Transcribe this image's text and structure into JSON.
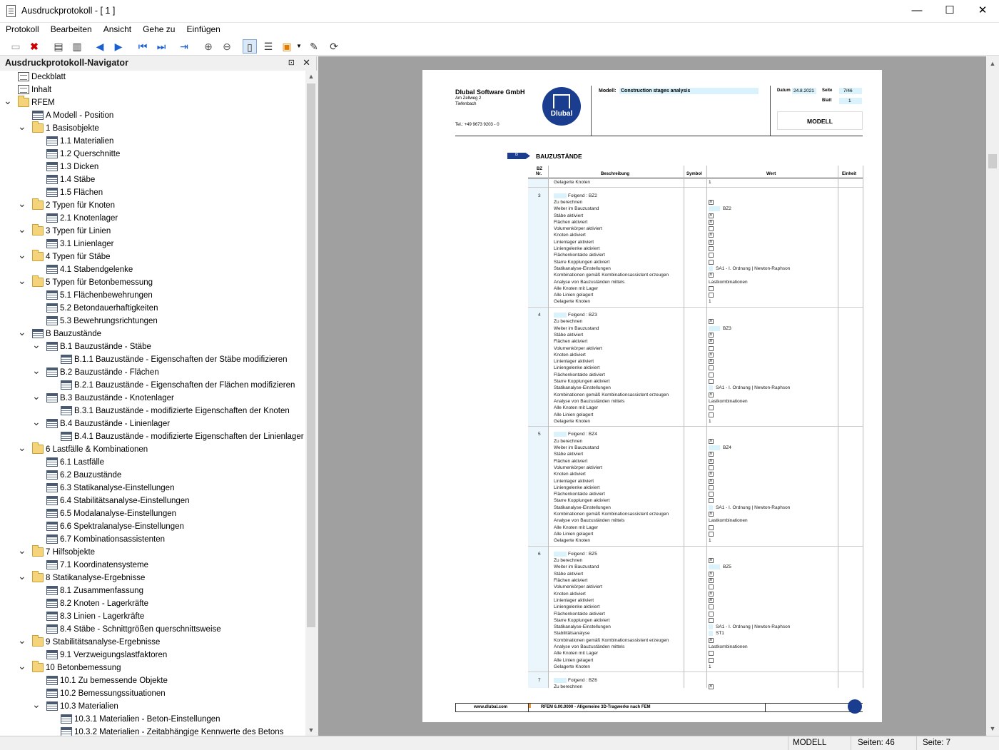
{
  "window": {
    "title": "Ausdruckprotokoll - [ 1 ]",
    "minimize": "—",
    "maximize": "☐",
    "close": "✕"
  },
  "menu": [
    "Protokoll",
    "Bearbeiten",
    "Ansicht",
    "Gehe zu",
    "Einfügen"
  ],
  "toolbar": {
    "icons": [
      "new-icon",
      "delete-icon",
      "print-icon",
      "print-setup-icon",
      "prev-icon",
      "next-icon",
      "first-icon",
      "last-icon",
      "goto-icon",
      "zoom-in-icon",
      "zoom-out-icon",
      "page-view-icon",
      "table-settings-icon",
      "print-options-icon",
      "dropdown-icon",
      "edit-icon",
      "refresh-icon"
    ]
  },
  "navigator": {
    "title": "Ausdruckprotokoll-Navigator",
    "pin": "⊡",
    "close": "✕",
    "items": [
      {
        "label": "Deckblatt",
        "level": 0,
        "icon": "doc",
        "chev": ""
      },
      {
        "label": "Inhalt",
        "level": 0,
        "icon": "doc",
        "chev": ""
      },
      {
        "label": "RFEM",
        "level": 0,
        "icon": "folder",
        "chev": "v"
      },
      {
        "label": "A Modell - Position",
        "level": 1,
        "icon": "tbl",
        "chev": ""
      },
      {
        "label": "1 Basisobjekte",
        "level": 1,
        "icon": "folder",
        "chev": "v"
      },
      {
        "label": "1.1 Materialien",
        "level": 2,
        "icon": "tbl",
        "chev": ""
      },
      {
        "label": "1.2 Querschnitte",
        "level": 2,
        "icon": "tbl",
        "chev": ""
      },
      {
        "label": "1.3 Dicken",
        "level": 2,
        "icon": "tbl",
        "chev": ""
      },
      {
        "label": "1.4 Stäbe",
        "level": 2,
        "icon": "tbl",
        "chev": ""
      },
      {
        "label": "1.5 Flächen",
        "level": 2,
        "icon": "tbl",
        "chev": ""
      },
      {
        "label": "2 Typen für Knoten",
        "level": 1,
        "icon": "folder",
        "chev": "v"
      },
      {
        "label": "2.1 Knotenlager",
        "level": 2,
        "icon": "tbl",
        "chev": ""
      },
      {
        "label": "3 Typen für Linien",
        "level": 1,
        "icon": "folder",
        "chev": "v"
      },
      {
        "label": "3.1 Linienlager",
        "level": 2,
        "icon": "tbl",
        "chev": ""
      },
      {
        "label": "4 Typen für Stäbe",
        "level": 1,
        "icon": "folder",
        "chev": "v"
      },
      {
        "label": "4.1 Stabendgelenke",
        "level": 2,
        "icon": "tbl",
        "chev": ""
      },
      {
        "label": "5 Typen für Betonbemessung",
        "level": 1,
        "icon": "folder",
        "chev": "v"
      },
      {
        "label": "5.1 Flächenbewehrungen",
        "level": 2,
        "icon": "tbl",
        "chev": ""
      },
      {
        "label": "5.2 Betondauerhaftigkeiten",
        "level": 2,
        "icon": "tbl",
        "chev": ""
      },
      {
        "label": "5.3 Bewehrungsrichtungen",
        "level": 2,
        "icon": "tbl",
        "chev": ""
      },
      {
        "label": "B Bauzustände",
        "level": 1,
        "icon": "tbl",
        "chev": "v"
      },
      {
        "label": "B.1 Bauzustände - Stäbe",
        "level": 2,
        "icon": "tbl",
        "chev": "v"
      },
      {
        "label": "B.1.1 Bauzustände - Eigenschaften der Stäbe modifizieren",
        "level": 3,
        "icon": "tbl",
        "chev": ""
      },
      {
        "label": "B.2 Bauzustände - Flächen",
        "level": 2,
        "icon": "tbl",
        "chev": "v"
      },
      {
        "label": "B.2.1 Bauzustände - Eigenschaften der Flächen modifizieren",
        "level": 3,
        "icon": "tbl",
        "chev": ""
      },
      {
        "label": "B.3 Bauzustände - Knotenlager",
        "level": 2,
        "icon": "tbl",
        "chev": "v"
      },
      {
        "label": "B.3.1 Bauzustände - modifizierte Eigenschaften der Knoten",
        "level": 3,
        "icon": "tbl",
        "chev": ""
      },
      {
        "label": "B.4 Bauzustände - Linienlager",
        "level": 2,
        "icon": "tbl",
        "chev": "v"
      },
      {
        "label": "B.4.1 Bauzustände - modifizierte Eigenschaften der Linienlager",
        "level": 3,
        "icon": "tbl",
        "chev": ""
      },
      {
        "label": "6 Lastfälle & Kombinationen",
        "level": 1,
        "icon": "folder",
        "chev": "v"
      },
      {
        "label": "6.1 Lastfälle",
        "level": 2,
        "icon": "tbl",
        "chev": ""
      },
      {
        "label": "6.2 Bauzustände",
        "level": 2,
        "icon": "tbl",
        "chev": ""
      },
      {
        "label": "6.3 Statikanalyse-Einstellungen",
        "level": 2,
        "icon": "tbl",
        "chev": ""
      },
      {
        "label": "6.4 Stabilitätsanalyse-Einstellungen",
        "level": 2,
        "icon": "tbl",
        "chev": ""
      },
      {
        "label": "6.5 Modalanalyse-Einstellungen",
        "level": 2,
        "icon": "tbl",
        "chev": ""
      },
      {
        "label": "6.6 Spektralanalyse-Einstellungen",
        "level": 2,
        "icon": "tbl",
        "chev": ""
      },
      {
        "label": "6.7 Kombinationsassistenten",
        "level": 2,
        "icon": "tbl",
        "chev": ""
      },
      {
        "label": "7 Hilfsobjekte",
        "level": 1,
        "icon": "folder",
        "chev": "v"
      },
      {
        "label": "7.1 Koordinatensysteme",
        "level": 2,
        "icon": "tbl",
        "chev": ""
      },
      {
        "label": "8 Statikanalyse-Ergebnisse",
        "level": 1,
        "icon": "folder",
        "chev": "v"
      },
      {
        "label": "8.1 Zusammenfassung",
        "level": 2,
        "icon": "tbl",
        "chev": ""
      },
      {
        "label": "8.2 Knoten - Lagerkräfte",
        "level": 2,
        "icon": "tbl",
        "chev": ""
      },
      {
        "label": "8.3 Linien - Lagerkräfte",
        "level": 2,
        "icon": "tbl",
        "chev": ""
      },
      {
        "label": "8.4 Stäbe - Schnittgrößen querschnittsweise",
        "level": 2,
        "icon": "tbl",
        "chev": ""
      },
      {
        "label": "9 Stabilitätsanalyse-Ergebnisse",
        "level": 1,
        "icon": "folder",
        "chev": "v"
      },
      {
        "label": "9.1 Verzweigungslastfaktoren",
        "level": 2,
        "icon": "tbl",
        "chev": ""
      },
      {
        "label": "10 Betonbemessung",
        "level": 1,
        "icon": "folder",
        "chev": "v"
      },
      {
        "label": "10.1 Zu bemessende Objekte",
        "level": 2,
        "icon": "tbl",
        "chev": ""
      },
      {
        "label": "10.2 Bemessungssituationen",
        "level": 2,
        "icon": "tbl",
        "chev": ""
      },
      {
        "label": "10.3 Materialien",
        "level": 2,
        "icon": "tbl",
        "chev": "v"
      },
      {
        "label": "10.3.1 Materialien - Beton-Einstellungen",
        "level": 3,
        "icon": "tbl",
        "chev": ""
      },
      {
        "label": "10.3.2 Materialien - Zeitabhängige Kennwerte des Betons",
        "level": 3,
        "icon": "tbl",
        "chev": ""
      }
    ]
  },
  "page": {
    "company": "Dlubal Software GmbH",
    "street": "Am Zellweg 2",
    "city": "Tiefenbach",
    "tel": "Tel.: +49 9673 9203 - 0",
    "logo_text": "Dlubal",
    "model_label": "Modell:",
    "model_value": "Construction stages analysis",
    "date_label": "Datum",
    "date_value": "24.8.2021",
    "seite_label": "Seite",
    "seite_value": "7/46",
    "blatt_label": "Blatt",
    "blatt_value": "1",
    "section_box": "MODELL",
    "chapter_tag": "B",
    "chapter_title": "BAUZUSTÄNDE",
    "col_bz": "BZ",
    "col_nr": "Nr.",
    "col_desc": "Beschreibung",
    "col_symbol": "Symbol",
    "col_wert": "Wert",
    "col_einheit": "Einheit",
    "top_row": {
      "label": "Gelagerte Knoten",
      "value": "1"
    },
    "blocks": [
      {
        "nr": "3",
        "folgend": "Folgend : BZ2",
        "weiter": "BZ2",
        "stab": false,
        "extra": []
      },
      {
        "nr": "4",
        "folgend": "Folgend : BZ3",
        "weiter": "BZ3",
        "stab": false,
        "extra": []
      },
      {
        "nr": "5",
        "folgend": "Folgend : BZ4",
        "weiter": "BZ4",
        "stab": false,
        "extra": []
      },
      {
        "nr": "6",
        "folgend": "Folgend : BZ5",
        "weiter": "BZ5",
        "stab": true,
        "extra": []
      }
    ],
    "rows": [
      {
        "label": "Zu berechnen",
        "type": "cbx"
      },
      {
        "label": "Weiter im Bauzustand",
        "type": "weiter"
      },
      {
        "label": "Stäbe aktiviert",
        "type": "cbx"
      },
      {
        "label": "Flächen aktiviert",
        "type": "cbx"
      },
      {
        "label": "Volumenkörper aktiviert",
        "type": "cb"
      },
      {
        "label": "Knoten aktiviert",
        "type": "cbx"
      },
      {
        "label": "Linienlager aktiviert",
        "type": "cbx"
      },
      {
        "label": "Liniengelenke aktiviert",
        "type": "cb"
      },
      {
        "label": "Flächenkontakte aktiviert",
        "type": "cb"
      },
      {
        "label": "Starre Kopplungen aktiviert",
        "type": "cb"
      },
      {
        "label": "Statikanalyse-Einstellungen",
        "type": "sa"
      },
      {
        "label": "Stabilitätsanalyse",
        "type": "st"
      },
      {
        "label": "Kombinationen gemäß Kombinationsassistent erzeugen",
        "type": "cbx"
      },
      {
        "label": "Analyse von Bauzuständen mittels",
        "type": "lk"
      },
      {
        "label": "Alle Knoten mit Lager",
        "type": "cb"
      },
      {
        "label": "Alle Linien gelagert",
        "type": "cb"
      },
      {
        "label": "Gelagerte Knoten",
        "type": "one"
      }
    ],
    "sa_value": "SA1 - I. Ordnung | Newton-Raphson",
    "st_value": "ST1",
    "lk_value": "Lastkombinationen",
    "one_value": "1",
    "last_block": {
      "nr": "7",
      "folgend": "Folgend : BZ6",
      "first_row": "Zu berechnen"
    },
    "footer_url": "www.dlubal.com",
    "footer_text": "RFEM 6.00.0000 - Allgemeine 3D-Tragwerke nach FEM"
  },
  "status": {
    "mode": "MODELL",
    "pages": "Seiten: 46",
    "page": "Seite: 7"
  },
  "colors": {
    "accent": "#1a3d8f",
    "cyan": "#d9f2fb",
    "viewer_bg": "#a0a0a0"
  }
}
